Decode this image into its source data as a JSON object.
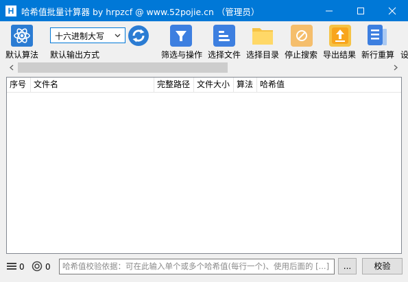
{
  "window": {
    "logo_letter": "H",
    "title": "哈希值批量计算器 by hrpzcf @ www.52pojie.cn （管理员）"
  },
  "toolbar": {
    "default_algorithm": "默认算法",
    "output_format_value": "十六进制大写",
    "output_format_label": "默认输出方式",
    "filter_label": "筛选与操作",
    "select_files_label": "选择文件",
    "select_dir_label": "选择目录",
    "stop_search_label": "停止搜索",
    "export_label": "导出结果",
    "new_reset_label": "新行重算",
    "overflow_label": "设"
  },
  "table": {
    "columns": [
      "序号",
      "文件名",
      "完整路径",
      "文件大小",
      "算法",
      "哈希值"
    ]
  },
  "status": {
    "list_count": "0",
    "target_count": "0",
    "hash_placeholder": "哈希值校验依据：可在此输入单个或多个哈希值(每行一个)、使用后面的 [...]",
    "browse_label": "...",
    "verify_label": "校验"
  },
  "colors": {
    "title_bar": "#0078d7",
    "accent": "#2b7cd3"
  }
}
